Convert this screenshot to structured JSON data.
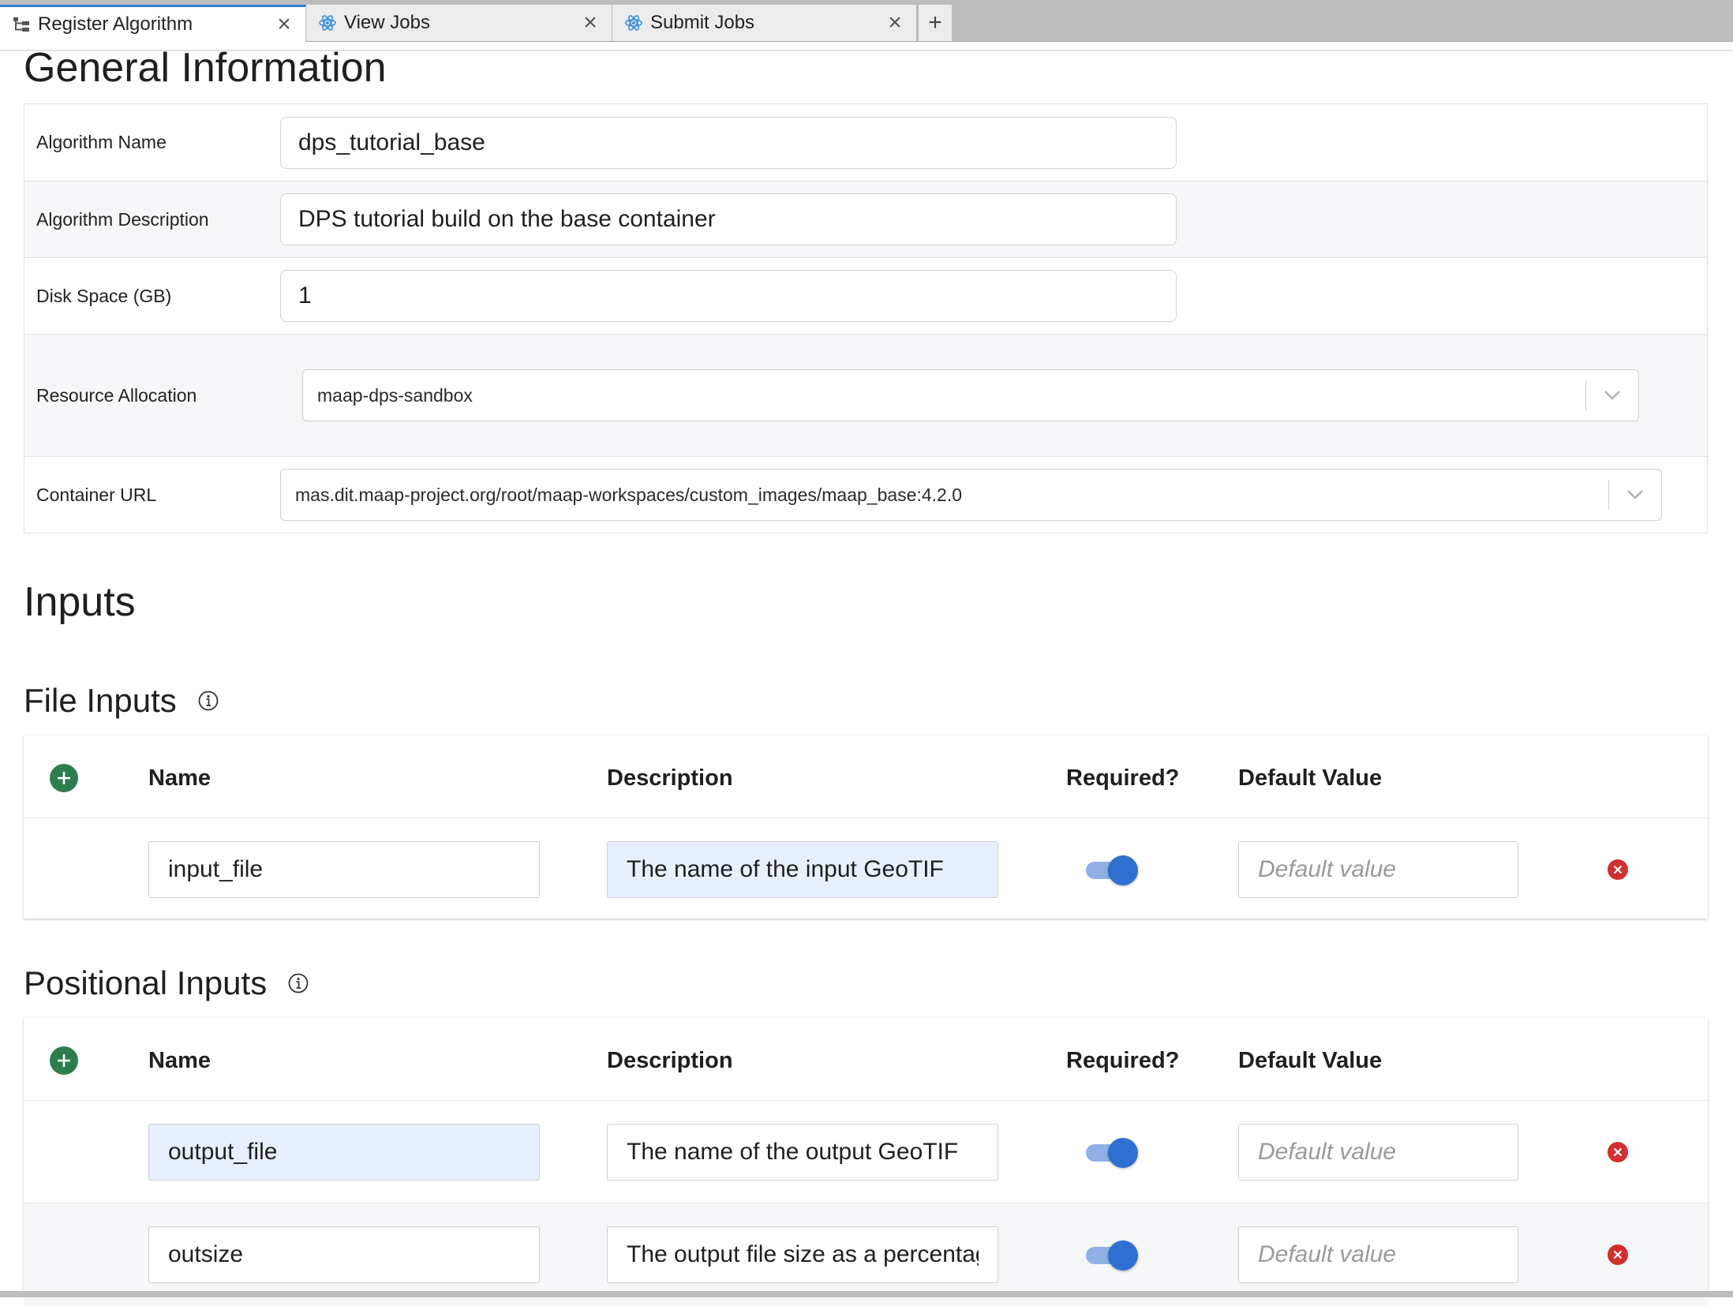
{
  "tabs": [
    {
      "label": "Register Algorithm",
      "icon": "tree-structure-icon",
      "active": true
    },
    {
      "label": "View Jobs",
      "icon": "react-atom-icon",
      "active": false
    },
    {
      "label": "Submit Jobs",
      "icon": "react-atom-icon",
      "active": false
    }
  ],
  "general": {
    "heading": "General Information",
    "algorithm_name": {
      "label": "Algorithm Name",
      "value": "dps_tutorial_base"
    },
    "algorithm_description": {
      "label": "Algorithm Description",
      "value": "DPS tutorial build on the base container"
    },
    "disk_space": {
      "label": "Disk Space (GB)",
      "value": "1"
    },
    "resource_allocation": {
      "label": "Resource Allocation",
      "value": "maap-dps-sandbox"
    },
    "container_url": {
      "label": "Container URL",
      "value": "mas.dit.maap-project.org/root/maap-workspaces/custom_images/maap_base:4.2.0"
    }
  },
  "inputs": {
    "heading": "Inputs",
    "columns": {
      "name": "Name",
      "description": "Description",
      "required": "Required?",
      "default": "Default Value"
    },
    "default_placeholder": "Default value",
    "file_inputs": {
      "heading": "File Inputs",
      "rows": [
        {
          "name": "input_file",
          "description": "The name of the input GeoTIF",
          "required": true,
          "default": ""
        }
      ]
    },
    "positional_inputs": {
      "heading": "Positional Inputs",
      "rows": [
        {
          "name": "output_file",
          "description": "The name of the output GeoTIF",
          "required": true,
          "default": ""
        },
        {
          "name": "outsize",
          "description": "The output file size as a percentag",
          "required": true,
          "default": ""
        }
      ]
    }
  },
  "colors": {
    "accent": "#2f7fd8",
    "add_green": "#2e7d4f",
    "delete_red": "#d32f2f",
    "toggle_on": "#2f6fd0",
    "autofill_bg": "#e8f0fe"
  }
}
